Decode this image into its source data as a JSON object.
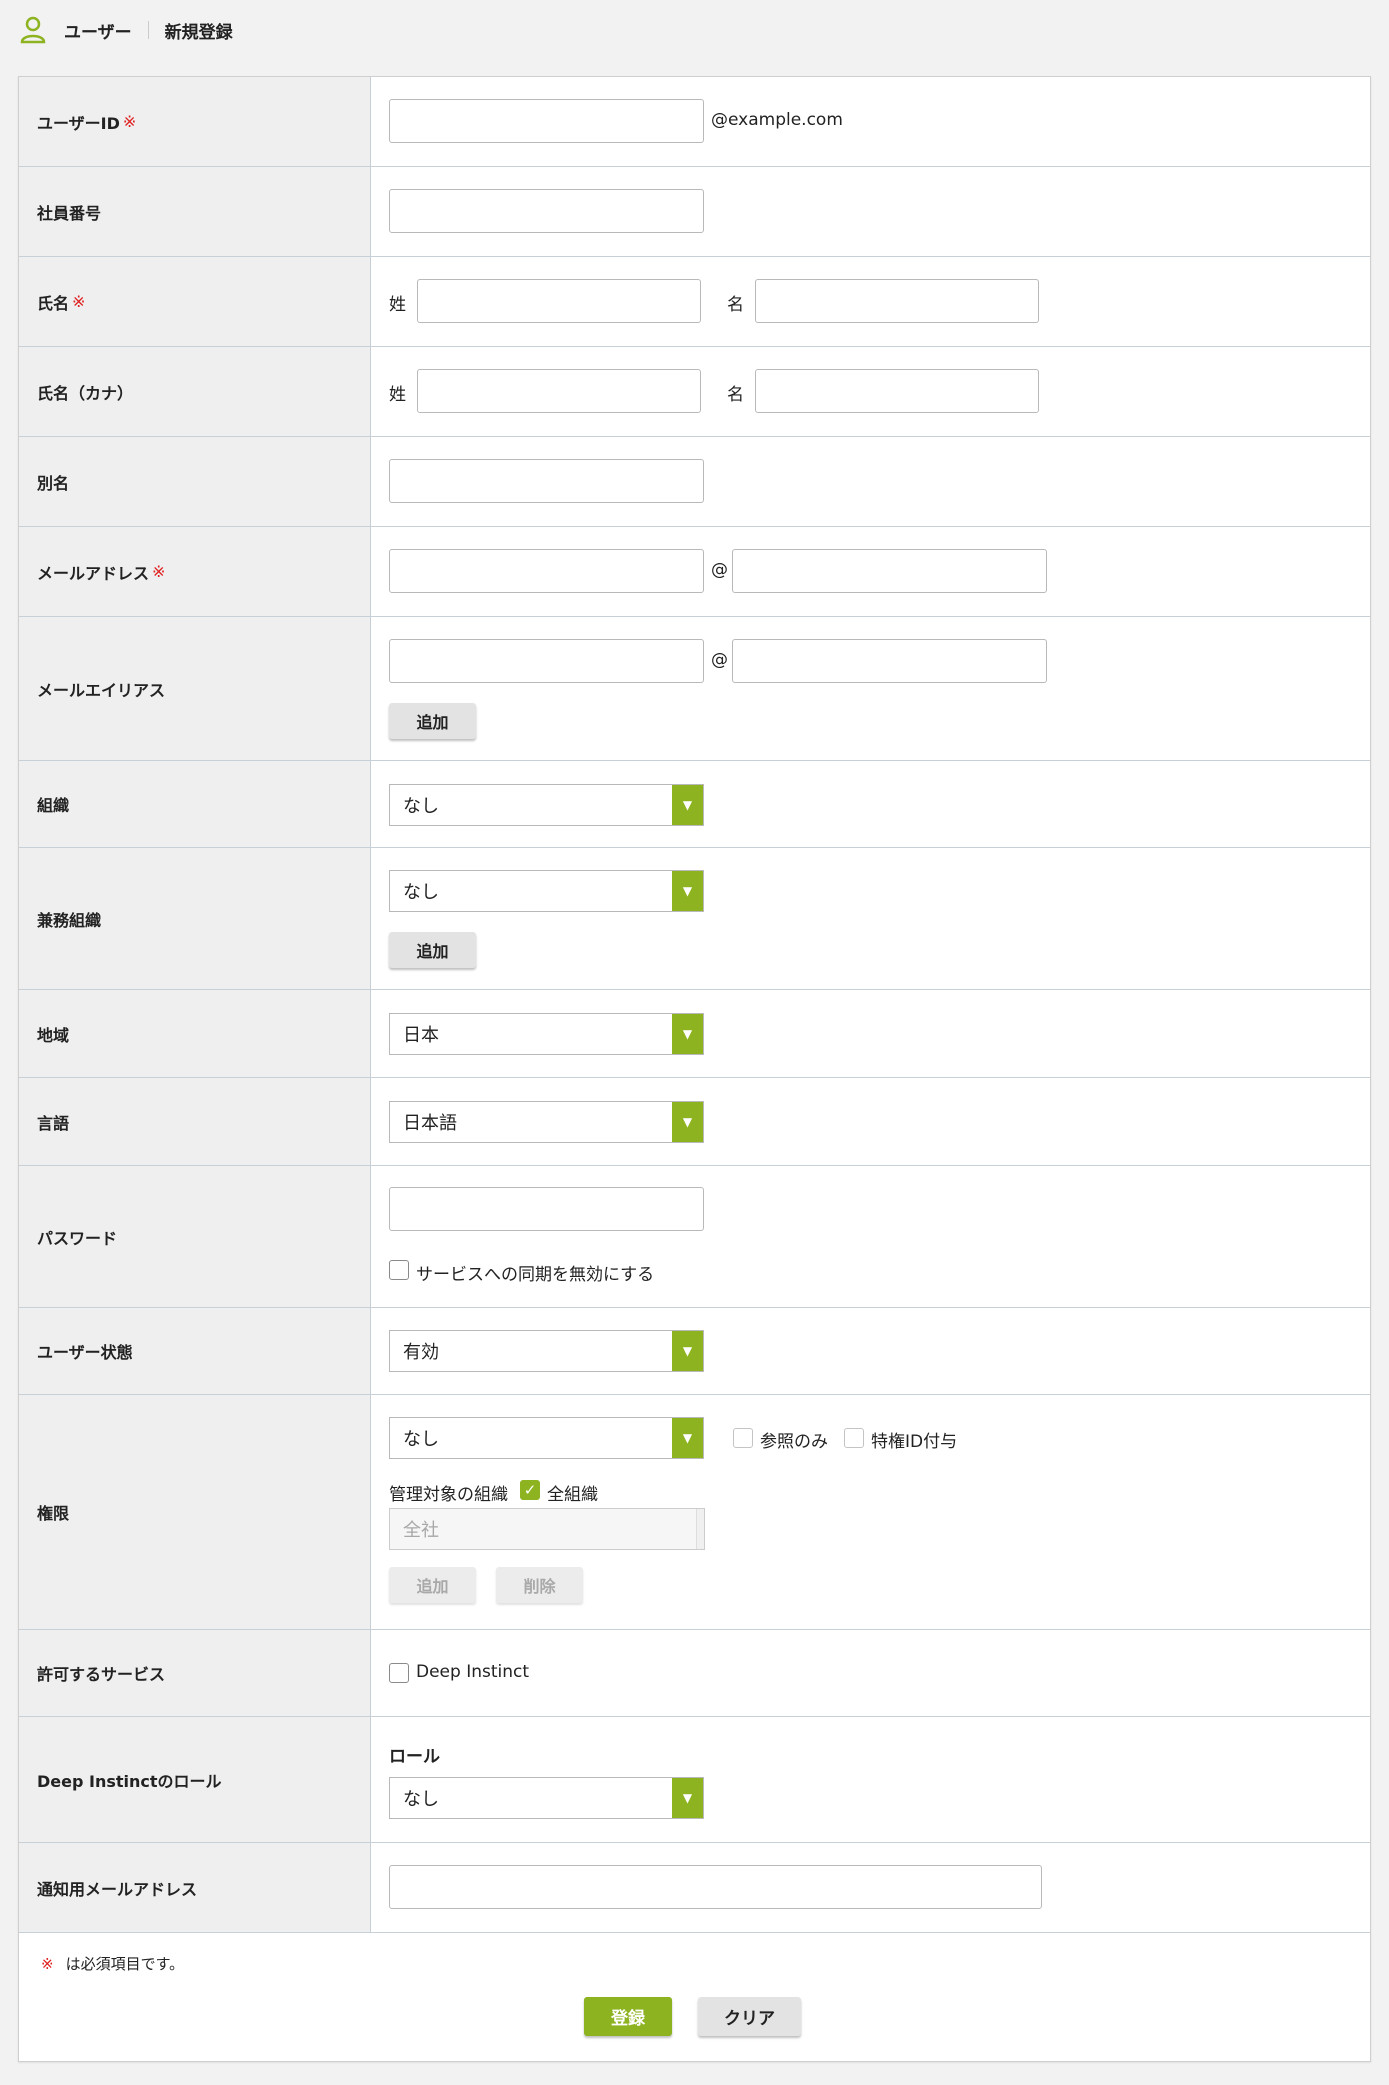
{
  "header": {
    "section": "ユーザー",
    "page": "新規登録"
  },
  "required_mark": "※",
  "rows": {
    "user_id": {
      "label": "ユーザーID",
      "domain_suffix": "@example.com"
    },
    "employee_no": {
      "label": "社員番号"
    },
    "name": {
      "label": "氏名",
      "sei": "姓",
      "mei": "名"
    },
    "name_kana": {
      "label": "氏名（カナ）",
      "sei": "姓",
      "mei": "名"
    },
    "alias": {
      "label": "別名"
    },
    "email": {
      "label": "メールアドレス",
      "at": "@"
    },
    "email_alias": {
      "label": "メールエイリアス",
      "at": "@",
      "add_label": "追加"
    },
    "org": {
      "label": "組織",
      "value": "なし"
    },
    "sub_org": {
      "label": "兼務組織",
      "value": "なし",
      "add_label": "追加"
    },
    "region": {
      "label": "地域",
      "value": "日本"
    },
    "language": {
      "label": "言語",
      "value": "日本語"
    },
    "password": {
      "label": "パスワード",
      "sync_disable_label": "サービスへの同期を無効にする"
    },
    "user_status": {
      "label": "ユーザー状態",
      "value": "有効"
    },
    "permission": {
      "label": "権限",
      "value": "なし",
      "readonly_label": "参照のみ",
      "privileged_label": "特権ID付与",
      "managed_org_label": "管理対象の組織",
      "all_org_label": "全組織",
      "org_value": "全社",
      "add_label": "追加",
      "delete_label": "削除"
    },
    "allowed_services": {
      "label": "許可するサービス",
      "service_label": "Deep Instinct"
    },
    "deep_role": {
      "label": "Deep Instinctのロール",
      "role_heading": "ロール",
      "value": "なし"
    },
    "notify_email": {
      "label": "通知用メールアドレス"
    }
  },
  "footer": {
    "required_note": "は必須項目です。",
    "submit_label": "登録",
    "clear_label": "クリア"
  },
  "colors": {
    "accent": "#8db321",
    "required": "#e02020"
  }
}
